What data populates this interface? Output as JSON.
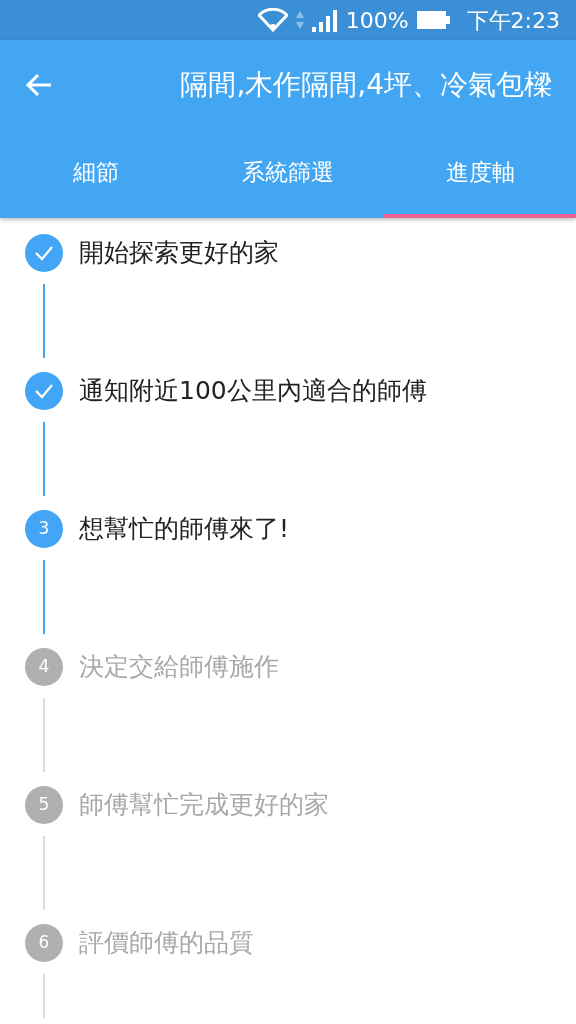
{
  "status_bar": {
    "battery": "100%",
    "time": "下午2:23"
  },
  "app_bar": {
    "title": "隔間,木作隔間,4坪、冷氣包樑"
  },
  "tabs": [
    {
      "label": "細節",
      "selected": false
    },
    {
      "label": "系統篩選",
      "selected": false
    },
    {
      "label": "進度軸",
      "selected": true
    }
  ],
  "steps": [
    {
      "kind": "done",
      "label": "開始探索更好的家"
    },
    {
      "kind": "done",
      "label": "通知附近100公里內適合的師傅"
    },
    {
      "kind": "active",
      "number": "3",
      "label": "想幫忙的師傅來了!"
    },
    {
      "kind": "pending",
      "number": "4",
      "label": "決定交給師傅施作"
    },
    {
      "kind": "pending",
      "number": "5",
      "label": "師傅幫忙完成更好的家"
    },
    {
      "kind": "pending",
      "number": "6",
      "label": "評價師傅的品質"
    }
  ]
}
